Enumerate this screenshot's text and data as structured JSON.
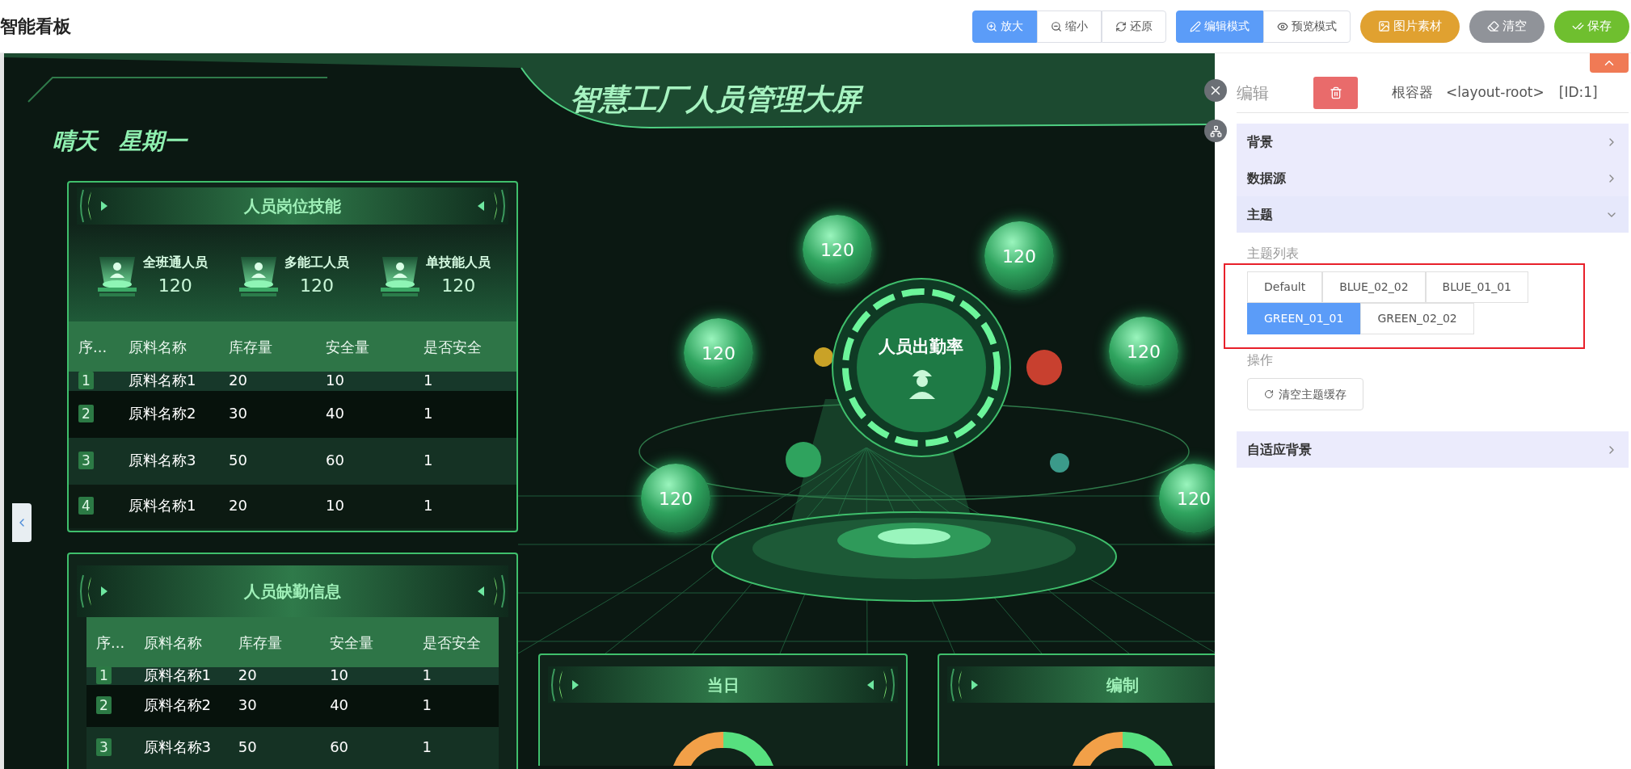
{
  "app_title": "智能看板",
  "zoom_group": [
    {
      "label": "放大",
      "selected": true
    },
    {
      "label": "缩小",
      "selected": false
    },
    {
      "label": "还原",
      "selected": false
    }
  ],
  "mode_group": [
    {
      "label": "编辑模式",
      "selected": true
    },
    {
      "label": "预览模式",
      "selected": false
    }
  ],
  "actions": [
    {
      "label": "图片素材",
      "color": "#e0a130"
    },
    {
      "label": "清空",
      "color": "#909399"
    },
    {
      "label": "保存",
      "color": "#6fbf2f"
    }
  ],
  "canvas": {
    "title": "智慧工厂人员管理大屏",
    "weather": "晴天",
    "weekday": "星期一",
    "skill_panel": {
      "title": "人员岗位技能",
      "stats": [
        {
          "label": "全班通人员",
          "value": "120"
        },
        {
          "label": "多能工人员",
          "value": "120"
        },
        {
          "label": "单技能人员",
          "value": "120"
        }
      ],
      "columns": [
        "序...",
        "原料名称",
        "库存量",
        "安全量",
        "是否安全"
      ],
      "rows": [
        [
          "1",
          "原料名称1",
          "20",
          "10",
          "1"
        ],
        [
          "2",
          "原料名称2",
          "30",
          "40",
          "1"
        ],
        [
          "3",
          "原料名称3",
          "50",
          "60",
          "1"
        ],
        [
          "4",
          "原料名称1",
          "20",
          "10",
          "1"
        ]
      ]
    },
    "absence_panel": {
      "title": "人员缺勤信息",
      "columns": [
        "序...",
        "原料名称",
        "库存量",
        "安全量",
        "是否安全"
      ],
      "rows": [
        [
          "1",
          "原料名称1",
          "20",
          "10",
          "1"
        ],
        [
          "2",
          "原料名称2",
          "30",
          "40",
          "1"
        ],
        [
          "3",
          "原料名称3",
          "50",
          "60",
          "1"
        ]
      ]
    },
    "bubbles": [
      "120",
      "120",
      "120",
      "120",
      "120",
      "120"
    ],
    "hub_label": "人员出勤率",
    "bottom_panels": [
      {
        "title": "当日"
      },
      {
        "title": "编制"
      }
    ]
  },
  "editor": {
    "heading": "编辑",
    "target": "根容器",
    "tag": "<layout-root>",
    "id": "[ID:1]",
    "sections": [
      {
        "title": "背景",
        "expanded": false,
        "kind": "plain"
      },
      {
        "title": "数据源",
        "expanded": false,
        "kind": "plain"
      },
      {
        "title": "主题",
        "expanded": true,
        "kind": "theme"
      },
      {
        "title": "自适应背景",
        "expanded": false,
        "kind": "plain"
      }
    ],
    "theme": {
      "list_label": "主题列表",
      "rows": [
        [
          {
            "label": "Default",
            "selected": false
          },
          {
            "label": "BLUE_02_02",
            "selected": false
          },
          {
            "label": "BLUE_01_01",
            "selected": false
          }
        ],
        [
          {
            "label": "GREEN_01_01",
            "selected": true
          },
          {
            "label": "GREEN_02_02",
            "selected": false
          }
        ]
      ],
      "ops_label": "操作",
      "clear_button": "清空主题缓存"
    }
  }
}
